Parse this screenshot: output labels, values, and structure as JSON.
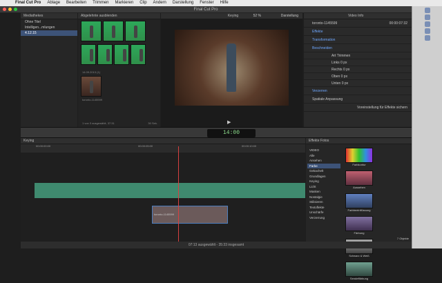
{
  "menu": {
    "app": "Final Cut Pro",
    "items": [
      "Ablage",
      "Bearbeiten",
      "Trimmen",
      "Markieren",
      "Clip",
      "Ändern",
      "Darstellung",
      "Fenster",
      "Hilfe"
    ]
  },
  "window_title": "Final Cut Pro",
  "library": {
    "header": "Mediathekes",
    "items": [
      "Ohne Titel",
      "Intelligen...mlungen",
      "4.12.15"
    ]
  },
  "browser": {
    "header": "Abgelehnte ausblenden",
    "date_label": "14.09.2013",
    "count": "(1)",
    "clip_name": "toronto-1145599",
    "footer": "1 von 3 ausgewählt, 37:31",
    "duration": "30 Sek."
  },
  "viewer": {
    "header": "Keying",
    "zoom": "52 %",
    "view_menu": "Darstellung"
  },
  "inspector": {
    "tabs": [
      "Video",
      "Info"
    ],
    "clip": "toronto-1145599",
    "time": "00:00:07:32",
    "sections": [
      "Effekte",
      "Transformation",
      "Beschneiden",
      "Verzerren",
      "Spatiale Anpassung"
    ],
    "crop": {
      "art_label": "Art",
      "art_value": "Trimmen",
      "rows": [
        "Links",
        "Rechts",
        "Oben",
        "Unten"
      ],
      "unit": "0 px"
    },
    "button": "Voreinstellung für Effekte sichern"
  },
  "toolbar": {
    "timecode": "14:00"
  },
  "timeline": {
    "name": "Keying",
    "times": [
      "00:00:00:00",
      "00:00:05:00",
      "00:00:10:00",
      "00:00:15:00"
    ],
    "clip_label": "toronto-1145599"
  },
  "effects": {
    "tabs": [
      "Effekte",
      "Fotos"
    ],
    "categories": [
      "VIDEO",
      "Alle",
      "Ansehen",
      "Farbe",
      "Gekachelt",
      "Grundlagen",
      "Keying",
      "Licht",
      "Masken",
      "Nostalgie",
      "Stilisieren",
      "Textoflekte",
      "Unschärfe",
      "Verzerrung"
    ],
    "items": [
      "Farbkontur",
      "Aussehen",
      "Farbbeeinflüssung",
      "Färbung",
      "Schwarz & Weiß",
      "Sendeffärbung"
    ],
    "count": "7 Objekte"
  },
  "status": "07:13 ausgewählt - 35:33 insgesamt"
}
